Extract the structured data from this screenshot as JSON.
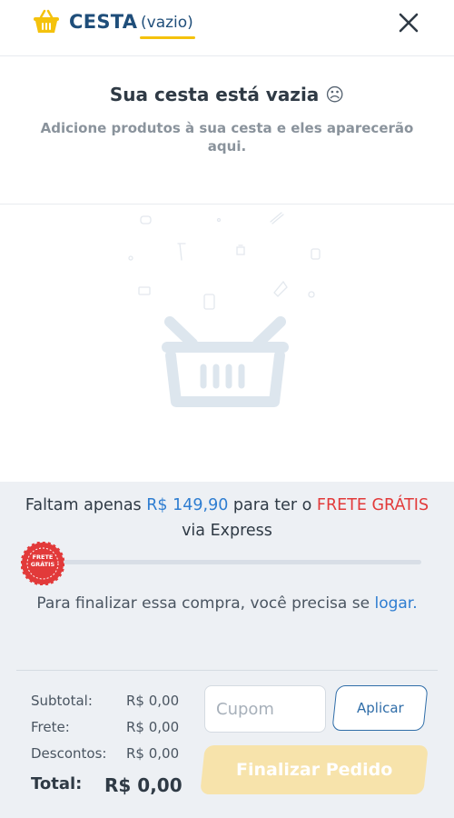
{
  "header": {
    "title": "CESTA",
    "status": "(vazio)",
    "logo_icon": "basket-icon",
    "close_icon": "close-icon",
    "accent_color": "#f4c20d",
    "title_color": "#1f4e7a"
  },
  "empty_state": {
    "title": "Sua cesta está vazia",
    "face": "☹",
    "subtitle": "Adicione produtos à sua cesta e eles aparecerão aqui.",
    "illustration_icon": "empty-basket-illustration"
  },
  "freight": {
    "prefix": "Faltam apenas",
    "amount": "R$ 149,90",
    "middle": "para ter o",
    "free_label": "FRETE GRÁTIS",
    "suffix": "via Express",
    "progress_percent": 0,
    "seal_line1": "FRETE",
    "seal_line2": "GRÁTIS",
    "seal_color": "#e23a3a"
  },
  "login": {
    "message": "Para finalizar essa compra, você precisa se",
    "link": "logar."
  },
  "summary": {
    "subtotal_label": "Subtotal:",
    "subtotal_value": "R$ 0,00",
    "shipping_label": "Frete:",
    "shipping_value": "R$ 0,00",
    "discount_label": "Descontos:",
    "discount_value": "R$ 0,00",
    "total_label": "Total:",
    "total_value": "R$ 0,00"
  },
  "coupon": {
    "placeholder": "Cupom",
    "value": "",
    "apply_label": "Aplicar"
  },
  "checkout": {
    "finalize_label": "Finalizar Pedido",
    "button_color": "#f7e3ab"
  }
}
